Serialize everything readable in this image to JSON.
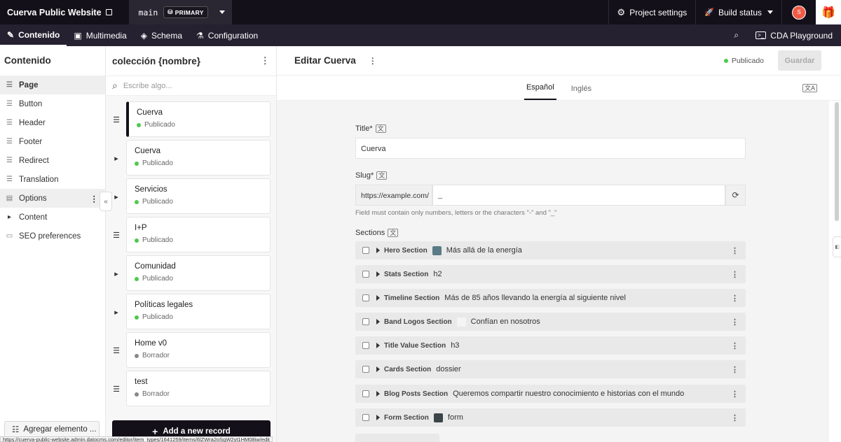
{
  "topbar": {
    "project_name": "Cuerva Public Website",
    "environment": "main",
    "env_badge": "PRIMARY",
    "project_settings": "Project settings",
    "build_status": "Build status",
    "avatar_initial": "S"
  },
  "navbar": {
    "tabs": [
      {
        "label": "Contenido",
        "icon": "edit-icon"
      },
      {
        "label": "Multimedia",
        "icon": "image-icon"
      },
      {
        "label": "Schema",
        "icon": "layers-icon"
      },
      {
        "label": "Configuration",
        "icon": "flask-icon"
      }
    ],
    "cda_playground": "CDA Playground"
  },
  "sidebar": {
    "title": "Contenido",
    "items": [
      {
        "label": "Page",
        "icon": "list-icon"
      },
      {
        "label": "Button",
        "icon": "list-icon"
      },
      {
        "label": "Header",
        "icon": "list-icon"
      },
      {
        "label": "Footer",
        "icon": "list-icon"
      },
      {
        "label": "Redirect",
        "icon": "list-icon"
      },
      {
        "label": "Translation",
        "icon": "list-icon"
      },
      {
        "label": "Options",
        "icon": "document-icon"
      },
      {
        "label": "Content",
        "icon": "caret-right-icon"
      },
      {
        "label": "SEO preferences",
        "icon": "archive-icon"
      }
    ],
    "add_element": "Agregar elemento ..."
  },
  "collection": {
    "title": "colección {nombre}",
    "search_placeholder": "Escribe algo...",
    "records": [
      {
        "title": "Cuerva",
        "status": "Publicado",
        "published": true,
        "handle": "drag"
      },
      {
        "title": "Cuerva",
        "status": "Publicado",
        "published": true,
        "handle": "expand"
      },
      {
        "title": "Servicios",
        "status": "Publicado",
        "published": true,
        "handle": "expand"
      },
      {
        "title": "I+P",
        "status": "Publicado",
        "published": true,
        "handle": "drag"
      },
      {
        "title": "Comunidad",
        "status": "Publicado",
        "published": true,
        "handle": "expand"
      },
      {
        "title": "Políticas legales",
        "status": "Publicado",
        "published": true,
        "handle": "expand"
      },
      {
        "title": "Home v0",
        "status": "Borrador",
        "published": false,
        "handle": "drag"
      },
      {
        "title": "test",
        "status": "Borrador",
        "published": false,
        "handle": "drag"
      }
    ],
    "new_record": "Add a new record"
  },
  "editor": {
    "title": "Editar Cuerva",
    "status": "Publicado",
    "save_label": "Guardar",
    "languages": [
      "Español",
      "Inglés"
    ],
    "title_label": "Title*",
    "title_value": "Cuerva",
    "slug_label": "Slug*",
    "slug_prefix": "https://example.com/",
    "slug_value": "_",
    "slug_hint": "Field must contain only numbers, letters or the characters \"-\" and \"_\"",
    "sections_label": "Sections",
    "sections": [
      {
        "name": "Hero Section",
        "value": "Más allá de la energía",
        "thumb": "#5a7a86"
      },
      {
        "name": "Stats Section",
        "value": "h2",
        "thumb": ""
      },
      {
        "name": "Timeline Section",
        "value": "Más de 85 años llevando la energía al siguiente nivel",
        "thumb": ""
      },
      {
        "name": "Band Logos Section",
        "value": "Confían en nosotros",
        "thumb": "#f4f4f4"
      },
      {
        "name": "Title Value Section",
        "value": "h3",
        "thumb": ""
      },
      {
        "name": "Cards Section",
        "value": "dossier",
        "thumb": ""
      },
      {
        "name": "Blog Posts Section",
        "value": "Queremos compartir nuestro conocimiento e historias con el mundo",
        "thumb": ""
      },
      {
        "name": "Form Section",
        "value": "form",
        "thumb": "#3b4448"
      }
    ]
  },
  "status_url": "https://cuerva-public-website.admin.datocms.com/editor/item_types/1641259/items/6lZWra2oSgW2yt1HM08iw/edit"
}
